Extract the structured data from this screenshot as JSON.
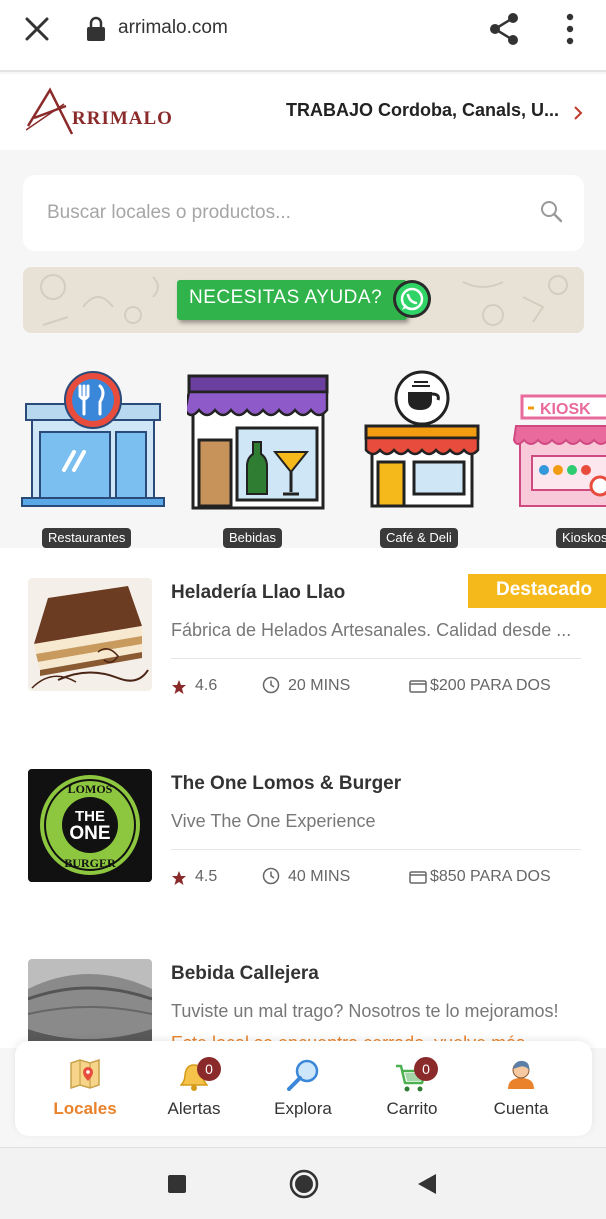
{
  "browser": {
    "url": "arrimalo.com",
    "icons": [
      "close-icon",
      "lock-icon",
      "share-icon",
      "more-vert-icon"
    ]
  },
  "header": {
    "logo_text": "RRIMALO",
    "location": "TRABAJO Cordoba, Canals, U..."
  },
  "search": {
    "placeholder": "Buscar locales o productos..."
  },
  "banner": {
    "text": "NECESITAS AYUDA?",
    "icon": "whatsapp-icon"
  },
  "categories": [
    {
      "label": "Restaurantes"
    },
    {
      "label": "Bebidas"
    },
    {
      "label": "Café & Deli"
    },
    {
      "label": "Kioskos"
    }
  ],
  "restaurants": [
    {
      "name": "Heladería Llao Llao",
      "description": "Fábrica de Helados Artesanales. Calidad desde ...",
      "rating": "4.6",
      "time": "20 MINS",
      "price": "$200 PARA DOS",
      "badge": "Destacado"
    },
    {
      "name": "The One Lomos & Burger",
      "description": "Vive The One Experience",
      "rating": "4.5",
      "time": "40 MINS",
      "price": "$850 PARA DOS",
      "logo_lines": [
        "LOMOS",
        "THE",
        "ONE",
        "BURGER"
      ]
    },
    {
      "name": "Bebida Callejera",
      "description": "Tuviste un mal trago? Nosotros te lo mejoramos!",
      "status": "Este local se encuentra cerrado, vuelve más"
    }
  ],
  "bottom_nav": [
    {
      "label": "Locales",
      "active": true,
      "icon": "map-icon"
    },
    {
      "label": "Alertas",
      "badge": "0",
      "icon": "bell-icon"
    },
    {
      "label": "Explora",
      "icon": "magnifier-icon"
    },
    {
      "label": "Carrito",
      "badge": "0",
      "icon": "cart-icon"
    },
    {
      "label": "Cuenta",
      "icon": "user-icon"
    }
  ],
  "colors": {
    "accent": "#e9822a",
    "badge": "#f6b91c",
    "notification": "#8b2a2a",
    "whatsapp": "#2fb34a",
    "logo": "#8b2a2a"
  }
}
